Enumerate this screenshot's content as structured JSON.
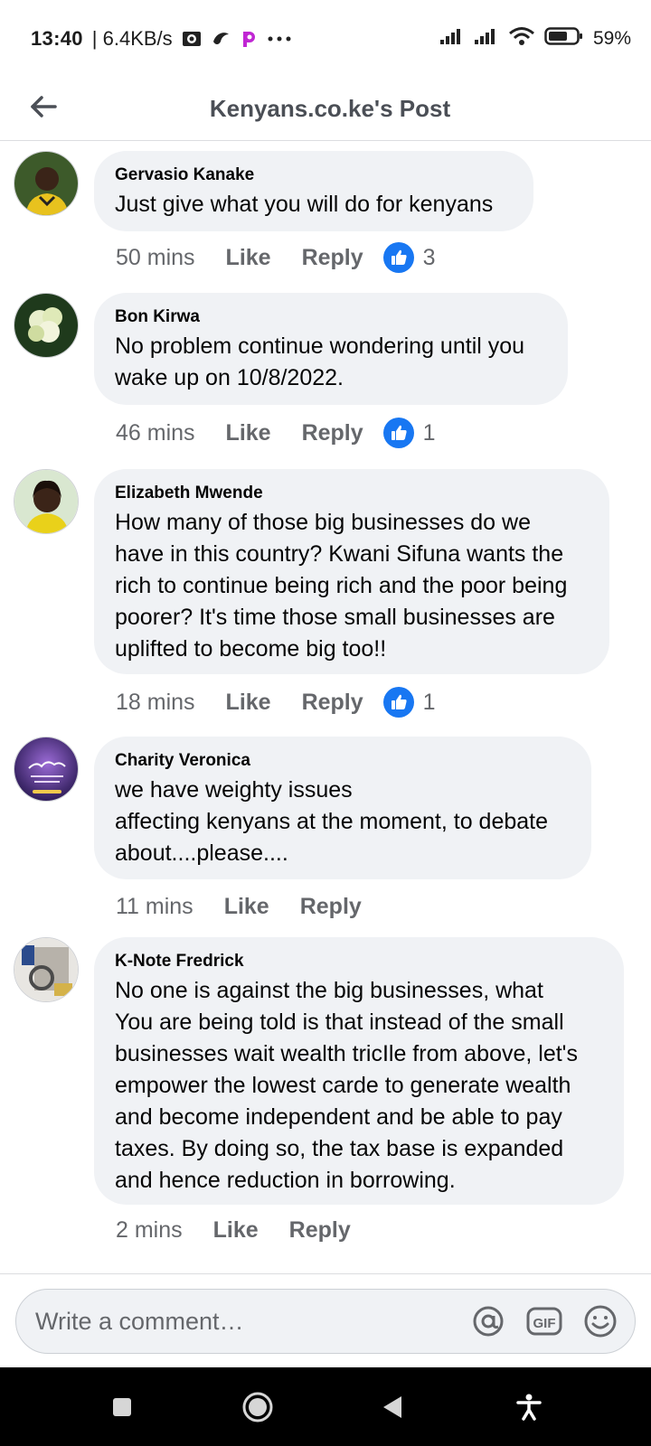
{
  "status_bar": {
    "time": "13:40",
    "network_speed": "| 6.4KB/s",
    "battery_percent": "59%",
    "icons": [
      "notification-app-icon",
      "bird-app-icon",
      "p-app-icon",
      "more-dots-icon",
      "signal-icon",
      "signal-icon",
      "wifi-icon",
      "battery-icon"
    ]
  },
  "header": {
    "title": "Kenyans.co.ke's Post"
  },
  "comments": [
    {
      "author": "Gervasio Kanake",
      "text": "Just give what you will do for kenyans",
      "time": "50 mins",
      "like_label": "Like",
      "reply_label": "Reply",
      "reactions": "3"
    },
    {
      "author": "Bon Kirwa",
      "text": "No problem continue wondering until you\nwake up on 10/8/2022.",
      "time": "46 mins",
      "like_label": "Like",
      "reply_label": "Reply",
      "reactions": "1"
    },
    {
      "author": "Elizabeth Mwende",
      "text": "How many of those big businesses do we\nhave in this country? Kwani Sifuna wants the\nrich to continue being rich and the poor being\npoorer? It's time those small businesses are\nuplifted to become big too!!",
      "time": "18 mins",
      "like_label": "Like",
      "reply_label": "Reply",
      "reactions": "1"
    },
    {
      "author": "Charity Veronica",
      "text": "we have weighty issues\naffecting kenyans at the moment, to debate\nabout....please....",
      "time": "11 mins",
      "like_label": "Like",
      "reply_label": "Reply",
      "reactions": ""
    },
    {
      "author": "K-Note Fredrick",
      "text": "No one is against the big businesses, what\nYou are being told is that instead of the small\nbusinesses wait wealth tricIle from above, let's\nempower the lowest carde to generate wealth\nand become independent and be able to pay\ntaxes. By doing so, the tax base is expanded\nand hence reduction in borrowing.",
      "time": "2 mins",
      "like_label": "Like",
      "reply_label": "Reply",
      "reactions": ""
    }
  ],
  "composer": {
    "placeholder": "Write a comment…",
    "icons": [
      "mention-icon",
      "gif-icon",
      "emoji-icon"
    ],
    "gif_label": "GIF"
  },
  "colors": {
    "accent": "#1877f2",
    "bubble": "#f0f2f5",
    "secondary_text": "#65676b"
  }
}
